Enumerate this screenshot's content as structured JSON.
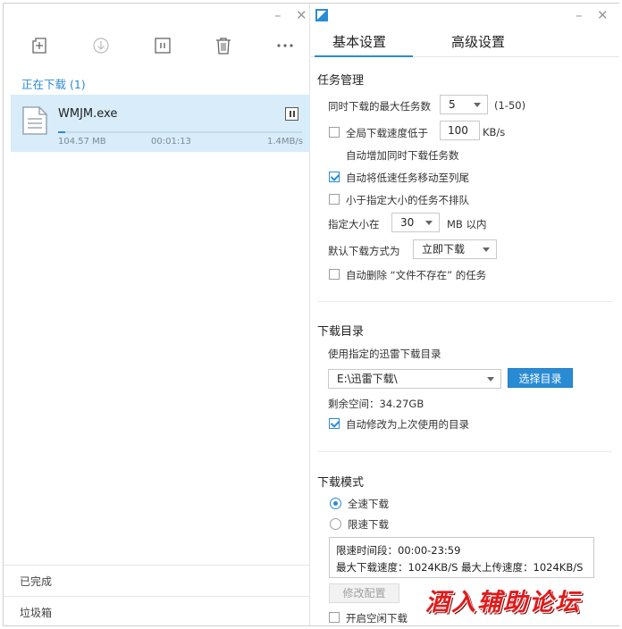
{
  "left": {
    "window_controls": {
      "minimize": "–",
      "close": "✕"
    },
    "toolbar": [
      "add-task",
      "download",
      "pause",
      "delete",
      "more"
    ],
    "downloading_section": "正在下载 (1)",
    "task": {
      "name": "WMJM.exe",
      "size": "104.57 MB",
      "elapsed": "00:01:13",
      "speed": "1.4MB/s",
      "progress": 0.03
    },
    "footer": {
      "completed": "已完成",
      "trash": "垃圾箱"
    }
  },
  "right": {
    "window_controls": {
      "minimize": "–",
      "close": "✕"
    },
    "tabs": [
      "基本设置",
      "高级设置"
    ],
    "task_mgmt": {
      "title": "任务管理",
      "max_tasks_label": "同时下载的最大任务数",
      "max_tasks_value": "5",
      "max_tasks_range": "(1-50)",
      "speed_below_label": "全局下载速度低于",
      "speed_below_value": "100",
      "speed_below_unit": "KB/s",
      "auto_increase_label": "自动增加同时下载任务数",
      "move_slow_label": "自动将低速任务移动至列尾",
      "no_queue_small_label": "小于指定大小的任务不排队",
      "size_label": "指定大小在",
      "size_value": "30",
      "size_unit": "MB 以内",
      "default_mode_label": "默认下载方式为",
      "default_mode_value": "立即下载",
      "auto_delete_label": "自动删除 “文件不存在” 的任务"
    },
    "download_dir": {
      "title": "下载目录",
      "use_dir_label": "使用指定的迅雷下载目录",
      "path": "E:\\迅雷下载\\",
      "choose_btn": "选择目录",
      "free_space": "剩余空间：34.27GB",
      "auto_modify_label": "自动修改为上次使用的目录"
    },
    "download_mode": {
      "title": "下载模式",
      "full_speed": "全速下载",
      "limited": "限速下载",
      "time_range": "限速时间段：00:00-23:59",
      "limits": "最大下载速度：1024KB/S  最大上传速度：1024KB/S",
      "modify_btn": "修改配置",
      "idle_label": "开启空闲下载"
    }
  },
  "watermark": "酒入辅助论坛",
  "colors": {
    "accent": "#2a8bd5",
    "selected_row": "#d8ecf9",
    "watermark": "#e01b1b"
  }
}
